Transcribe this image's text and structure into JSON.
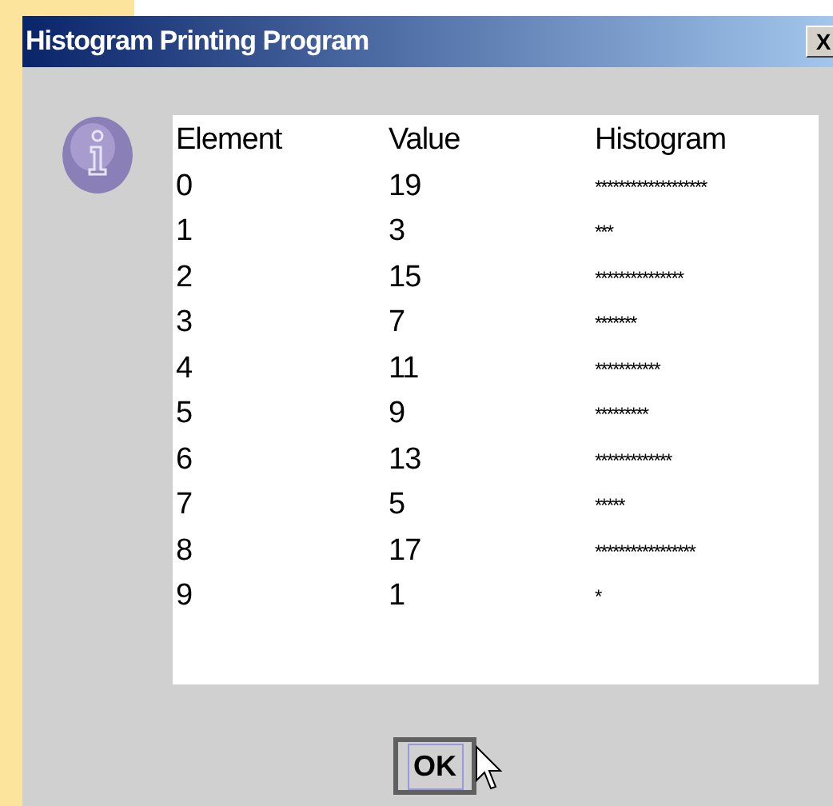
{
  "window": {
    "title": "Histogram Printing Program",
    "close": "X"
  },
  "table": {
    "columns": [
      "Element",
      "Value",
      "Histogram"
    ],
    "rows": [
      [
        "0",
        "19",
        "*******************"
      ],
      [
        "1",
        "3",
        "***"
      ],
      [
        "2",
        "15",
        "***************"
      ],
      [
        "3",
        "7",
        "*******"
      ],
      [
        "4",
        "11",
        "***********"
      ],
      [
        "5",
        "9",
        "*********"
      ],
      [
        "6",
        "13",
        "*************"
      ],
      [
        "7",
        "5",
        "*****"
      ],
      [
        "8",
        "17",
        "*****************"
      ],
      [
        "9",
        "1",
        "*"
      ]
    ]
  },
  "buttons": [
    "OK"
  ]
}
